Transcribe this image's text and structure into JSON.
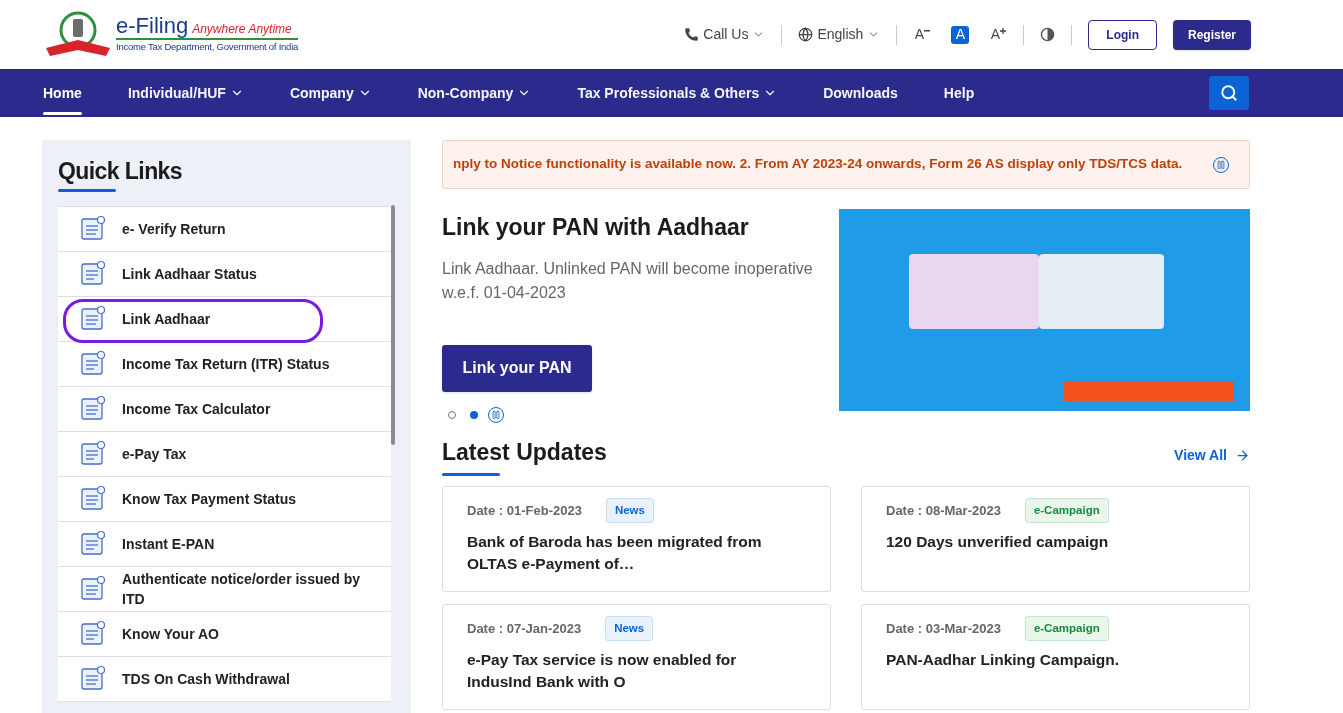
{
  "logo": {
    "title": "e-Filing",
    "tagline": "Anywhere Anytime",
    "subtitle": "Income Tax Department, Government of India"
  },
  "top_bar": {
    "call": "Call Us",
    "language": "English",
    "font_sizes": [
      {
        "label": "A",
        "kind": "decrease",
        "selected": false
      },
      {
        "label": "A",
        "kind": "normal",
        "selected": true
      },
      {
        "label": "A",
        "kind": "increase",
        "selected": false
      }
    ],
    "login": "Login",
    "register": "Register"
  },
  "nav": [
    {
      "label": "Home",
      "selected": true,
      "dropdown": false
    },
    {
      "label": "Individual/HUF",
      "selected": false,
      "dropdown": true
    },
    {
      "label": "Company",
      "selected": false,
      "dropdown": true
    },
    {
      "label": "Non-Company",
      "selected": false,
      "dropdown": true
    },
    {
      "label": "Tax Professionals & Others",
      "selected": false,
      "dropdown": true
    },
    {
      "label": "Downloads",
      "selected": false,
      "dropdown": false
    },
    {
      "label": "Help",
      "selected": false,
      "dropdown": false
    }
  ],
  "quick_links": {
    "title": "Quick Links",
    "items": [
      {
        "label": "e- Verify Return",
        "highlighted": false
      },
      {
        "label": "Link Aadhaar Status",
        "highlighted": false
      },
      {
        "label": "Link Aadhaar",
        "highlighted": true
      },
      {
        "label": "Income Tax Return (ITR) Status",
        "highlighted": false
      },
      {
        "label": "Income Tax Calculator",
        "highlighted": false
      },
      {
        "label": "e-Pay Tax",
        "highlighted": false
      },
      {
        "label": "Know Tax Payment Status",
        "highlighted": false
      },
      {
        "label": "Instant E-PAN",
        "highlighted": false
      },
      {
        "label": "Authenticate notice/order issued by ITD",
        "highlighted": false
      },
      {
        "label": "Know Your AO",
        "highlighted": false
      },
      {
        "label": "TDS On Cash Withdrawal",
        "highlighted": false
      }
    ]
  },
  "ticker": "nply to Notice functionality is available now. 2. From AY 2023-24 onwards, Form 26 AS display only TDS/TCS data.",
  "hero": {
    "title": "Link your PAN with Aadhaar",
    "text": "Link Aadhaar. Unlinked PAN will become inoperative w.e.f. 01-04-2023",
    "button": "Link your PAN",
    "dots": [
      {
        "selected": false
      },
      {
        "selected": true
      }
    ]
  },
  "latest_updates": {
    "title": "Latest Updates",
    "view_all": "View All",
    "cards": [
      {
        "date": "Date : 01-Feb-2023",
        "tag": "News",
        "kind": "news",
        "text": "Bank of Baroda has been migrated from OLTAS e-Payment of…"
      },
      {
        "date": "Date : 08-Mar-2023",
        "tag": "e-Campaign",
        "kind": "campaign",
        "text": "120 Days unverified campaign"
      },
      {
        "date": "Date : 07-Jan-2023",
        "tag": "News",
        "kind": "news",
        "text": "e-Pay Tax service is now enabled for IndusInd Bank with O"
      },
      {
        "date": "Date : 03-Mar-2023",
        "tag": "e-Campaign",
        "kind": "campaign",
        "text": "PAN-Aadhar Linking Campaign."
      }
    ]
  }
}
